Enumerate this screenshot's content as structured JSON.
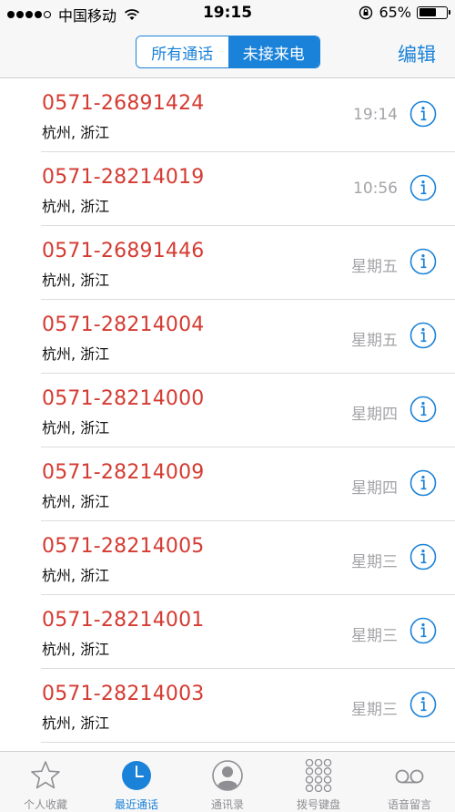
{
  "status_bar": {
    "carrier": "中国移动",
    "time": "19:15",
    "battery_percent": "65%",
    "battery_level": 0.65,
    "signal_bars_filled": 4,
    "signal_bars_total": 5
  },
  "nav": {
    "segments": [
      {
        "label": "所有通话",
        "active": false
      },
      {
        "label": "未接来电",
        "active": true
      }
    ],
    "edit_label": "编辑"
  },
  "calls": [
    {
      "number": "0571-26891424",
      "location": "杭州, 浙江",
      "time": "19:14"
    },
    {
      "number": "0571-28214019",
      "location": "杭州, 浙江",
      "time": "10:56"
    },
    {
      "number": "0571-26891446",
      "location": "杭州, 浙江",
      "time": "星期五"
    },
    {
      "number": "0571-28214004",
      "location": "杭州, 浙江",
      "time": "星期五"
    },
    {
      "number": "0571-28214000",
      "location": "杭州, 浙江",
      "time": "星期四"
    },
    {
      "number": "0571-28214009",
      "location": "杭州, 浙江",
      "time": "星期四"
    },
    {
      "number": "0571-28214005",
      "location": "杭州, 浙江",
      "time": "星期三"
    },
    {
      "number": "0571-28214001",
      "location": "杭州, 浙江",
      "time": "星期三"
    },
    {
      "number": "0571-28214003",
      "location": "杭州, 浙江",
      "time": "星期三"
    }
  ],
  "tabs": [
    {
      "label": "个人收藏",
      "icon": "star-icon",
      "active": false
    },
    {
      "label": "最近通话",
      "icon": "clock-icon",
      "active": true
    },
    {
      "label": "通讯录",
      "icon": "contacts-icon",
      "active": false
    },
    {
      "label": "拨号键盘",
      "icon": "keypad-icon",
      "active": false
    },
    {
      "label": "语音留言",
      "icon": "voicemail-icon",
      "active": false
    }
  ],
  "colors": {
    "accent": "#1a82d9",
    "missed_call": "#d43b32",
    "secondary_text": "#a4a4a8",
    "tab_inactive": "#8e8e93"
  }
}
